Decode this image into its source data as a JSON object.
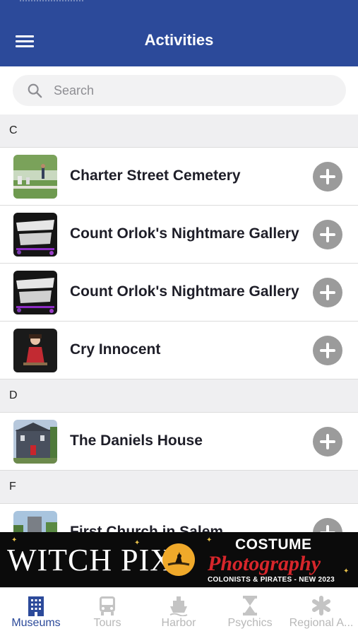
{
  "header": {
    "title": "Activities"
  },
  "search": {
    "placeholder": "Search"
  },
  "sections": [
    {
      "letter": "C",
      "items": [
        {
          "label": "Charter Street Cemetery",
          "thumb": "cemetery-photo"
        },
        {
          "label": "Count Orlok's Nightmare Gallery",
          "thumb": "nightmare-gallery-logo"
        },
        {
          "label": "Count Orlok's Nightmare Gallery",
          "thumb": "nightmare-gallery-logo"
        },
        {
          "label": "Cry Innocent",
          "thumb": "cry-innocent-photo"
        }
      ]
    },
    {
      "letter": "D",
      "items": [
        {
          "label": "The Daniels House",
          "thumb": "daniels-house-photo"
        }
      ]
    },
    {
      "letter": "F",
      "items": [
        {
          "label": "First Church in Salem",
          "thumb": "first-church-photo"
        }
      ]
    }
  ],
  "banner": {
    "brand": "WITCH PIX",
    "headline": "COSTUME",
    "script": "Photography",
    "tagline": "COLONISTS & PIRATES - NEW 2023"
  },
  "tabs": [
    {
      "label": "Museums",
      "icon": "building-icon",
      "active": true
    },
    {
      "label": "Tours",
      "icon": "bus-icon",
      "active": false
    },
    {
      "label": "Harbor",
      "icon": "ship-icon",
      "active": false
    },
    {
      "label": "Psychics",
      "icon": "hourglass-icon",
      "active": false
    },
    {
      "label": "Regional A...",
      "icon": "asterisk-icon",
      "active": false
    }
  ],
  "colors": {
    "header": "#2c4a9a",
    "active_tab": "#2c4a9a",
    "inactive_tab": "#b8b8b8",
    "add_button": "#9b9b9b"
  }
}
